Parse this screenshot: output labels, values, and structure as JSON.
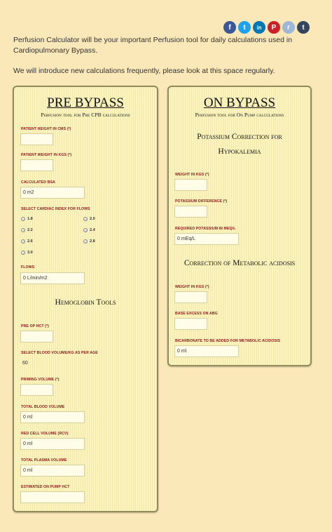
{
  "social": [
    {
      "name": "facebook-icon",
      "glyph": "f",
      "color": "#3b5998"
    },
    {
      "name": "twitter-icon",
      "glyph": "t",
      "color": "#1da1f2"
    },
    {
      "name": "linkedin-icon",
      "glyph": "in",
      "color": "#0077b5"
    },
    {
      "name": "pinterest-icon",
      "glyph": "P",
      "color": "#cb2027"
    },
    {
      "name": "reddit-icon",
      "glyph": "r",
      "color": "#9fb7d6"
    },
    {
      "name": "tumblr-icon",
      "glyph": "t",
      "color": "#35465c"
    }
  ],
  "intro": {
    "line1": "Perfusion Calculator will be your important Perfusion tool for daily calculations used in Cardiopulmonary Bypass.",
    "line2": "We will introduce new calculations frequently, please look at this space regularly."
  },
  "pre_bypass": {
    "title": "PRE BYPASS",
    "subtitle": "Perfusion tool for Pre CPB calculations",
    "patient_height_label": "PATIENT HEIGHT IN CMS (*)",
    "patient_height_value": "",
    "patient_weight_label": "PATIENT WEIGHT IN KGS (*)",
    "patient_weight_value": "",
    "bsa_label": "CALCULATED BSA",
    "bsa_value": "0 m2",
    "ci_label": "SELECT CARDIAC INDEX FOR FLOWS",
    "ci_options": [
      "1.8",
      "2.0",
      "2.2",
      "2.4",
      "2.6",
      "2.8",
      "3.0"
    ],
    "flows_label": "FLOWS",
    "flows_value": "0 L/min/m2",
    "hb_title": "Hemoglobin Tools",
    "pre_op_hct_label": "PRE OP HCT (*)",
    "pre_op_hct_value": "",
    "blood_vol_label": "SELECT BLOOD VOLUME/KG AS PER AGE",
    "blood_vol_value": "60",
    "priming_label": "PRIMING VOLUME (*)",
    "priming_value": "",
    "tbv_label": "TOTAL BLOOD VOLUME",
    "tbv_value": "0 ml",
    "rcv_label": "RED CELL VOLUME (RCV)",
    "rcv_value": "0 ml",
    "tpv_label": "TOTAL PLASMA VOLUME",
    "tpv_value": "0 ml",
    "on_pump_hct_label": "ESTIMATED ON PUMP HCT",
    "on_pump_hct_value": ""
  },
  "on_bypass": {
    "title": "ON BYPASS",
    "subtitle": "Perfusion tool for On Pump calculations",
    "k_title_1": "Potassium Correction for",
    "k_title_2": "Hypokalemia",
    "k_weight_label": "WEIGHT IN KGS (*)",
    "k_weight_value": "",
    "k_diff_label": "POTASSIUM DIFFERENCE (*)",
    "k_diff_value": "",
    "k_req_label": "REQUIRED POTASSIUM IN MEQ/L",
    "k_req_value": "0 mEq/L",
    "acid_title": "Correction of Metabolic acidosis",
    "acid_weight_label": "WEIGHT IN KGS (*)",
    "acid_weight_value": "",
    "base_excess_label": "BASE EXCESS ON ABG",
    "base_excess_value": "",
    "bicarb_label": "BICARBONATE TO BE ADDED FOR METABOLIC ACIDOSIS",
    "bicarb_value": "0 ml"
  }
}
